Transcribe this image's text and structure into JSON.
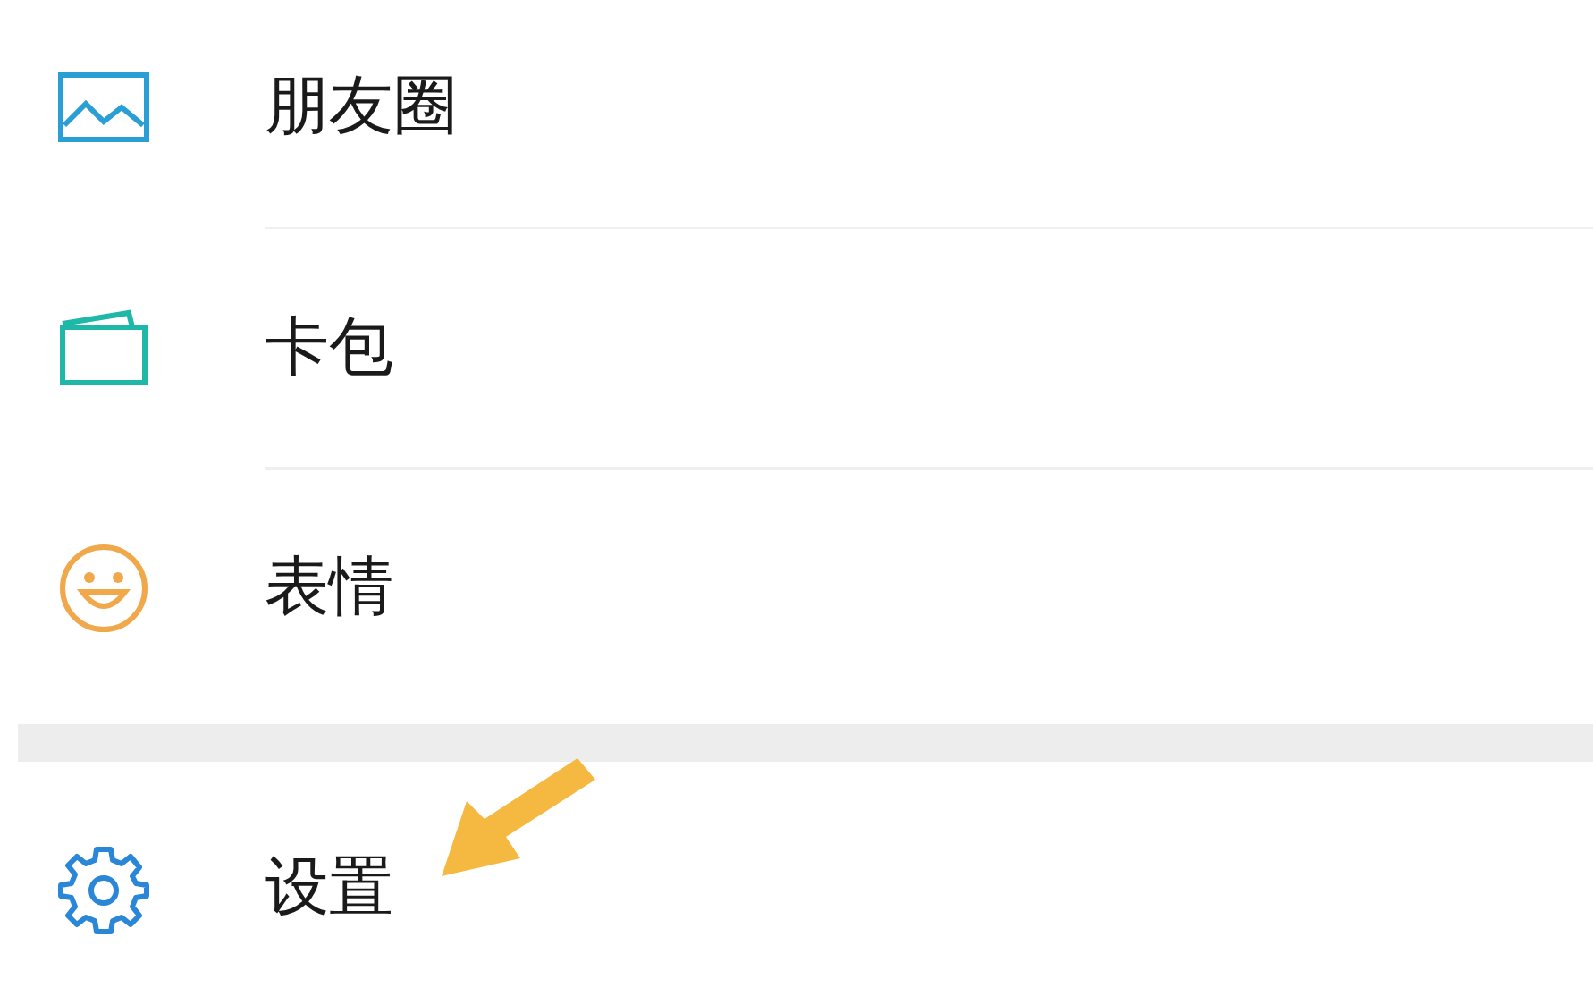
{
  "sections": [
    {
      "items": [
        {
          "kind": "moments",
          "label": "朋友圈"
        },
        {
          "kind": "cards",
          "label": "卡包"
        },
        {
          "kind": "stickers",
          "label": "表情"
        }
      ]
    },
    {
      "items": [
        {
          "kind": "settings",
          "label": "设置"
        }
      ]
    }
  ]
}
